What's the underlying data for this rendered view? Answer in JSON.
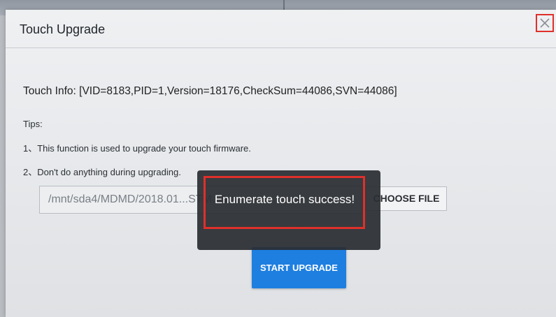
{
  "dialog": {
    "title": "Touch Upgrade",
    "close_icon": "close-icon",
    "touch_info": "Touch Info: [VID=8183,PID=1,Version=18176,CheckSum=44086,SVN=44086]",
    "tips_label": "Tips:",
    "tips": [
      "1、This function is used to upgrade your touch firmware.",
      "2、Don't do anything during upgrading."
    ],
    "file_path": "/mnt/sda4/MDMD/2018.01...STM...bin",
    "choose_file_label": "CHOOSE FILE",
    "start_upgrade_label": "START UPGRADE"
  },
  "toast": {
    "message": "Enumerate touch success!"
  },
  "colors": {
    "accent_blue": "#1e7fe0",
    "highlight_red": "#e0302a",
    "toast_bg": "#2a2d32"
  }
}
